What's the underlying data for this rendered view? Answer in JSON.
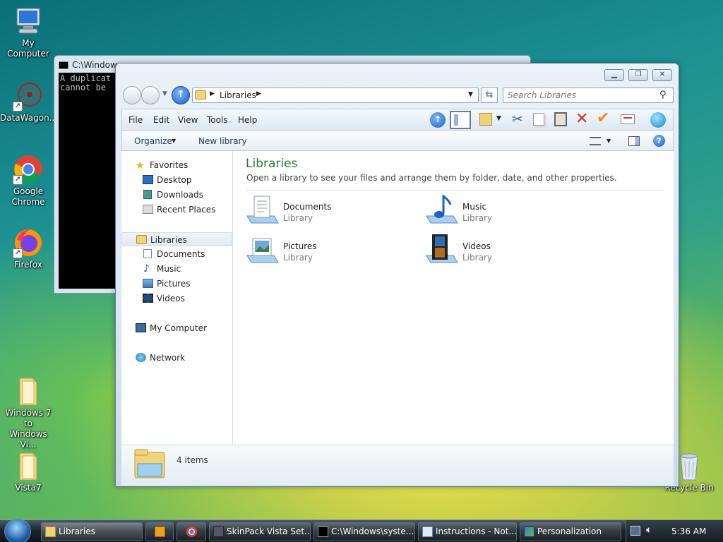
{
  "desktop": {
    "icons": [
      {
        "label": "My Computer",
        "icon": "computer-icon"
      },
      {
        "label": "DataWagon...",
        "icon": "datawagon-icon"
      },
      {
        "label": "Google\nChrome",
        "label1": "Google",
        "label2": "Chrome",
        "icon": "chrome-icon"
      },
      {
        "label": "Firefox",
        "icon": "firefox-icon"
      },
      {
        "label1": "Windows 7 to",
        "label2": "Windows Vi...",
        "icon": "folder-icon"
      },
      {
        "label": "Vista7",
        "icon": "folder-icon"
      },
      {
        "label": "Recycle Bin",
        "icon": "recycle-bin-icon"
      }
    ]
  },
  "cmd_window": {
    "title": "C:\\Window",
    "lines": [
      "A duplicat",
      "cannot be"
    ]
  },
  "explorer": {
    "address": {
      "crumb": "Libraries"
    },
    "search": {
      "placeholder": "Search Libraries"
    },
    "menu": [
      "File",
      "Edit",
      "View",
      "Tools",
      "Help"
    ],
    "commands": {
      "organize": "Organize",
      "new_library": "New library"
    },
    "nav": {
      "favorites": "Favorites",
      "desktop": "Desktop",
      "downloads": "Downloads",
      "recent_places": "Recent Places",
      "libraries": "Libraries",
      "documents": "Documents",
      "music": "Music",
      "pictures": "Pictures",
      "videos": "Videos",
      "my_computer": "My Computer",
      "network": "Network"
    },
    "content": {
      "title": "Libraries",
      "subtitle": "Open a library to see your files and arrange them by folder, date, and other properties.",
      "items": [
        {
          "name": "Documents",
          "type": "Library",
          "icon": "documents-library-icon"
        },
        {
          "name": "Music",
          "type": "Library",
          "icon": "music-library-icon"
        },
        {
          "name": "Pictures",
          "type": "Library",
          "icon": "pictures-library-icon"
        },
        {
          "name": "Videos",
          "type": "Library",
          "icon": "videos-library-icon"
        }
      ]
    },
    "status": {
      "count": "4 items"
    }
  },
  "taskbar": {
    "buttons": [
      {
        "label": "Libraries"
      },
      {
        "label": "SkinPack Vista Set..."
      },
      {
        "label": "C:\\Windows\\syste..."
      },
      {
        "label": "Instructions - Not..."
      },
      {
        "label": "Personalization"
      }
    ],
    "clock": "5:36 AM"
  },
  "colors": {
    "title_green": "#1e7d32",
    "accent_blue": "#1a64c8",
    "taskbar": "#1c252c"
  }
}
